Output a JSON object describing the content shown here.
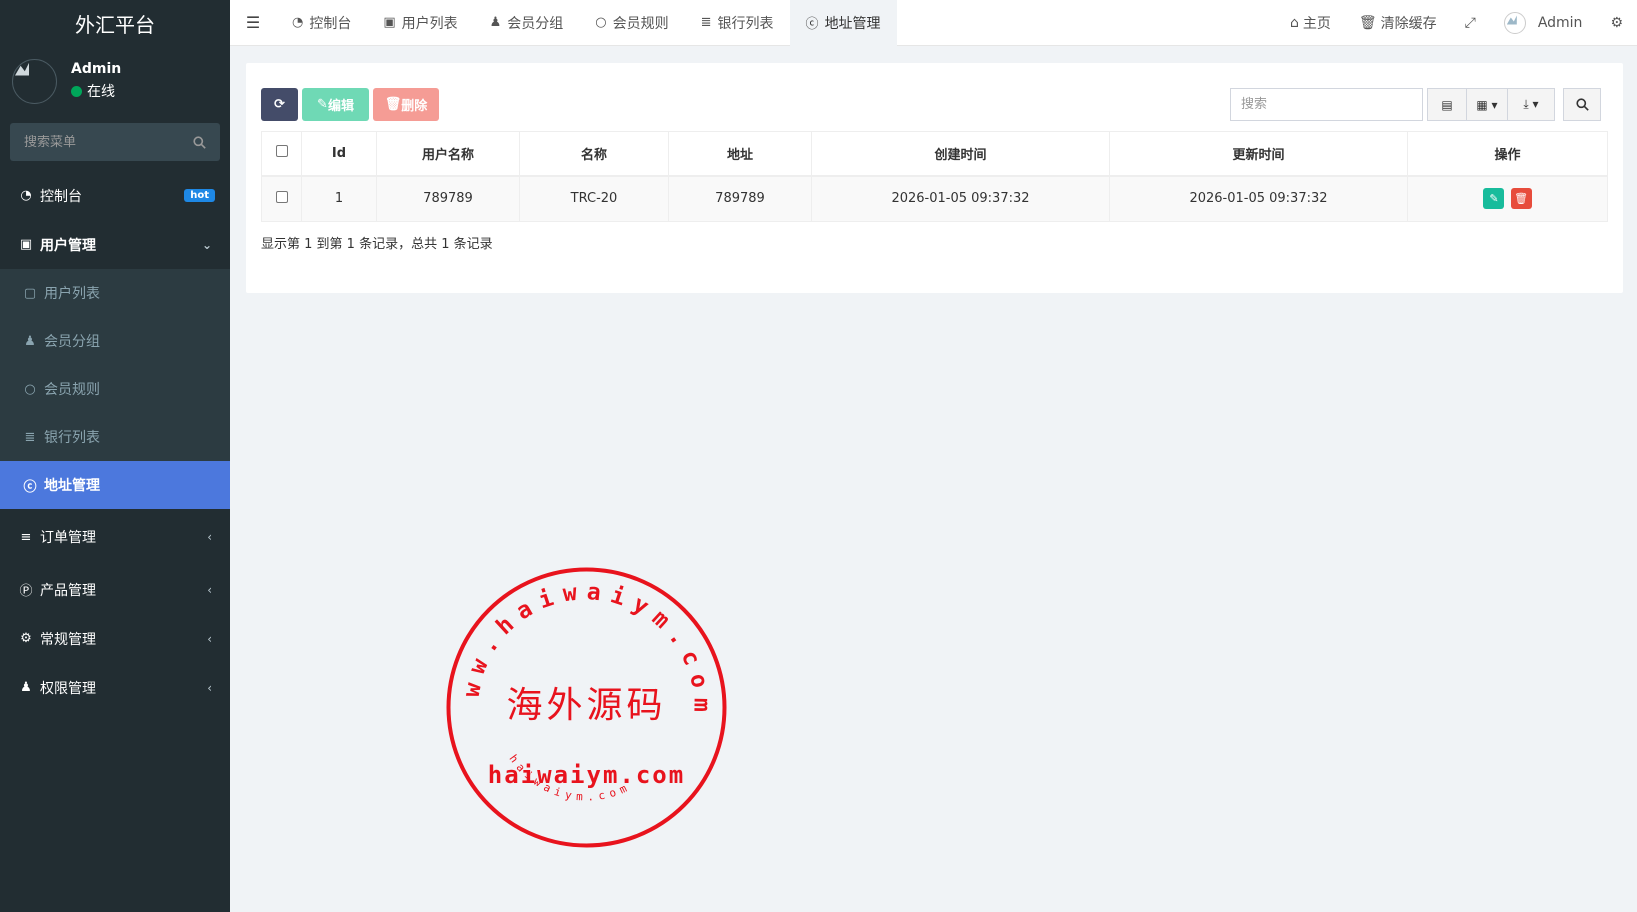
{
  "brand": "外汇平台",
  "user": {
    "name": "Admin",
    "status": "在线"
  },
  "sidebar": {
    "search_placeholder": "搜索菜单",
    "items": [
      {
        "label": "控制台",
        "icon": "dashboard-icon",
        "badge": "hot"
      },
      {
        "label": "用户管理",
        "icon": "user-card-icon"
      },
      {
        "label": "用户列表",
        "icon": "user-card-icon"
      },
      {
        "label": "会员分组",
        "icon": "users-icon"
      },
      {
        "label": "会员规则",
        "icon": "circle-icon"
      },
      {
        "label": "银行列表",
        "icon": "database-icon"
      },
      {
        "label": "地址管理",
        "icon": "cc-icon"
      },
      {
        "label": "订单管理",
        "icon": "list-icon"
      },
      {
        "label": "产品管理",
        "icon": "product-icon"
      },
      {
        "label": "常规管理",
        "icon": "cogs-icon"
      },
      {
        "label": "权限管理",
        "icon": "group-icon"
      }
    ]
  },
  "topnav": {
    "tabs": [
      {
        "label": "控制台",
        "icon": "dashboard-icon"
      },
      {
        "label": "用户列表",
        "icon": "user-card-icon"
      },
      {
        "label": "会员分组",
        "icon": "users-icon"
      },
      {
        "label": "会员规则",
        "icon": "circle-icon"
      },
      {
        "label": "银行列表",
        "icon": "database-icon"
      },
      {
        "label": "地址管理",
        "icon": "cc-icon"
      }
    ],
    "right": {
      "home": "主页",
      "clear_cache": "清除缓存",
      "admin": "Admin"
    }
  },
  "toolbar": {
    "edit": "编辑",
    "delete": "删除",
    "search_placeholder": "搜索"
  },
  "table": {
    "headers": [
      "Id",
      "用户名称",
      "名称",
      "地址",
      "创建时间",
      "更新时间",
      "操作"
    ],
    "rows": [
      {
        "id": "1",
        "username": "789789",
        "name": "TRC-20",
        "address": "789789",
        "created": "2026-01-05 09:37:32",
        "updated": "2026-01-05 09:37:32"
      }
    ]
  },
  "pagination_text": "显示第 1 到第 1 条记录，总共 1 条记录",
  "watermark": {
    "center": "海外源码",
    "bottom": "haiwaiym.com",
    "ring": "www.haiwaiym.com",
    "inner_ring": "haiwaiym.com"
  }
}
